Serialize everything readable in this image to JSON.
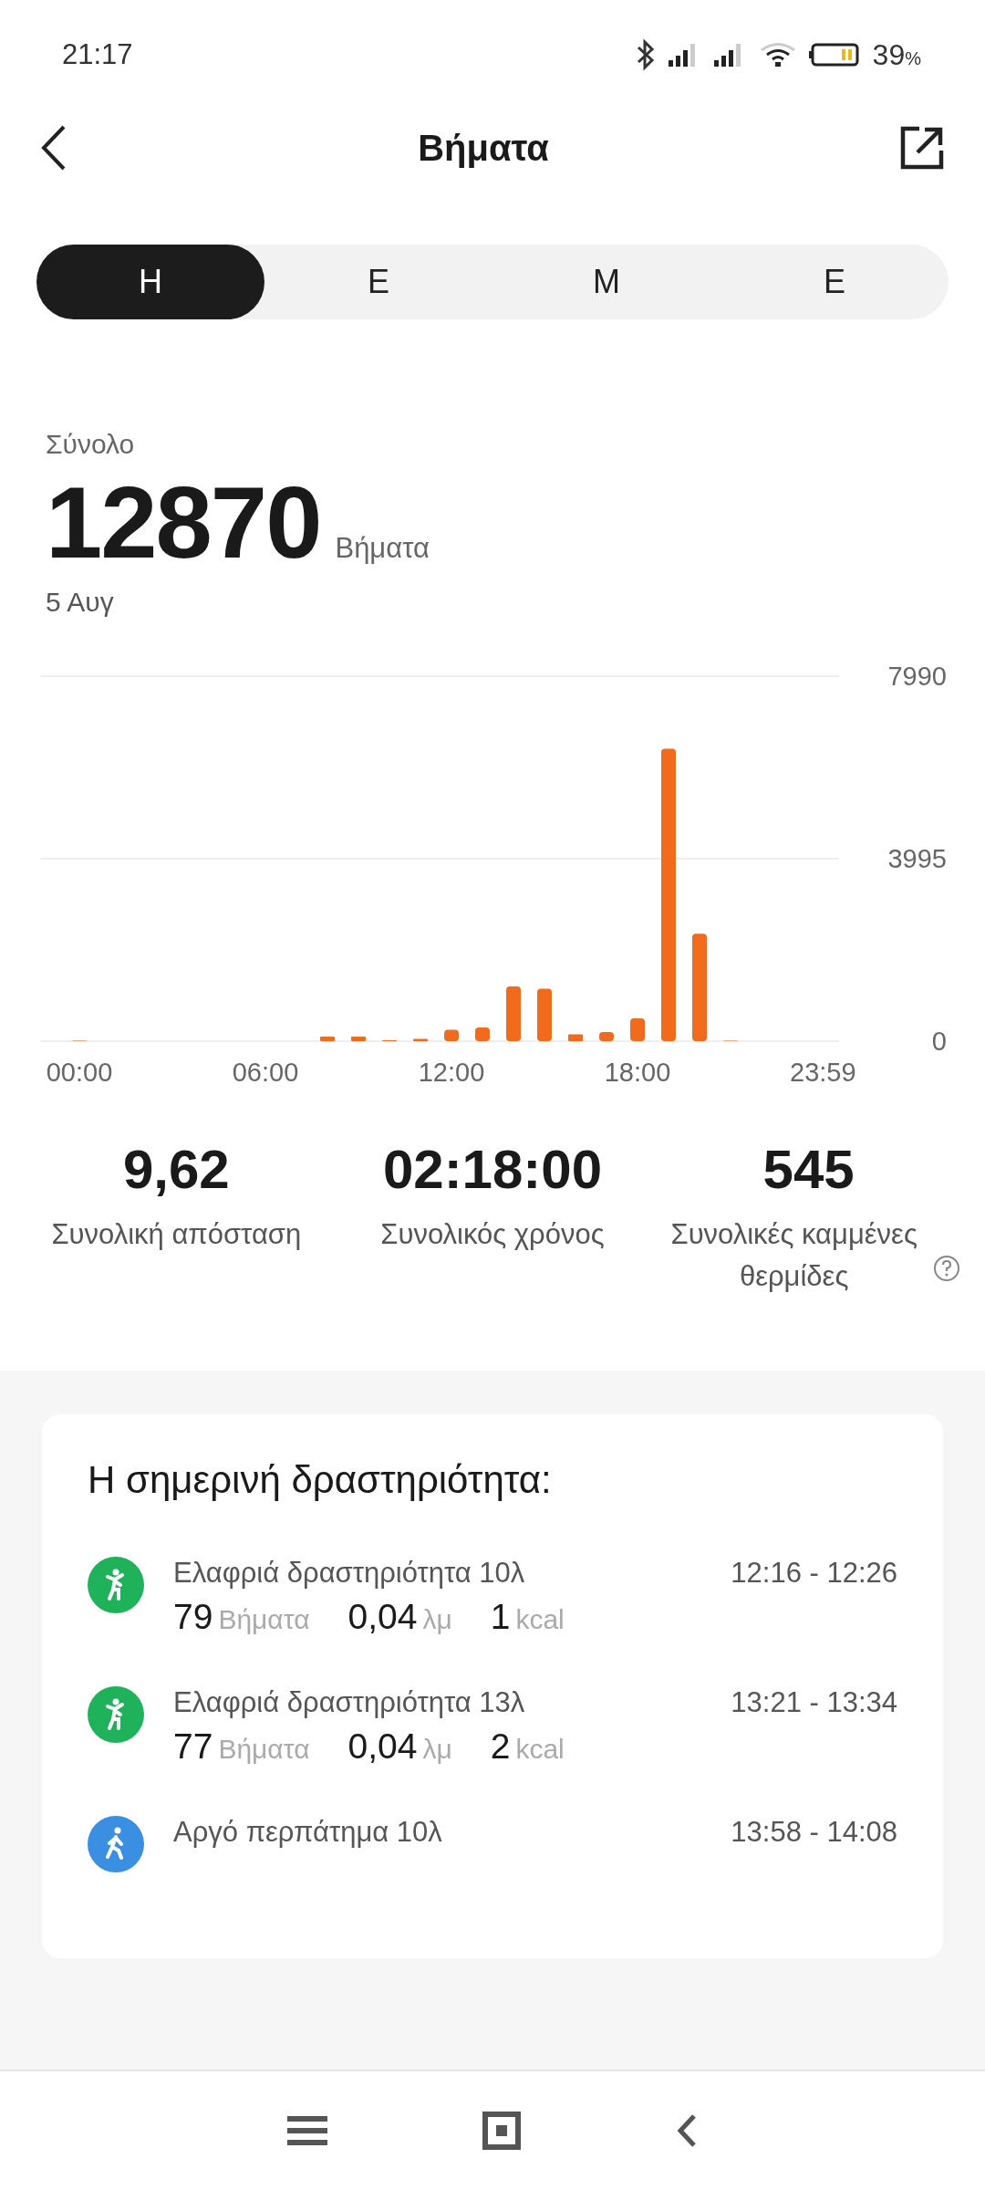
{
  "status_bar": {
    "time": "21:17",
    "battery": "39",
    "battery_unit": "%"
  },
  "header": {
    "title": "Βήματα"
  },
  "tabs": [
    {
      "label": "Η",
      "selected": true
    },
    {
      "label": "Ε",
      "selected": false
    },
    {
      "label": "Μ",
      "selected": false
    },
    {
      "label": "Ε",
      "selected": false
    }
  ],
  "summary": {
    "label": "Σύνολο",
    "value": "12870",
    "unit": "Βήματα",
    "date": "5 Αυγ"
  },
  "chart_data": {
    "type": "bar",
    "x": [
      0,
      1,
      2,
      3,
      4,
      5,
      6,
      7,
      8,
      9,
      10,
      11,
      12,
      13,
      14,
      15,
      16,
      17,
      18,
      19,
      20,
      21,
      22,
      23
    ],
    "values": [
      10,
      0,
      0,
      0,
      0,
      0,
      0,
      0,
      100,
      100,
      20,
      50,
      250,
      300,
      1200,
      1150,
      150,
      200,
      500,
      6400,
      2350,
      10,
      0,
      0
    ],
    "xlim": [
      -1.25,
      24.5
    ],
    "ylim": [
      0,
      7990
    ],
    "yticks": [
      0,
      3995,
      7990
    ],
    "xticks": [
      {
        "value": 0,
        "label": "00:00"
      },
      {
        "value": 6,
        "label": "06:00"
      },
      {
        "value": 12,
        "label": "12:00"
      },
      {
        "value": 18,
        "label": "18:00"
      },
      {
        "value": 23.98,
        "label": "23:59"
      }
    ]
  },
  "stats": [
    {
      "value": "9,62",
      "label": "Συνολική απόσταση",
      "help": false
    },
    {
      "value": "02:18:00",
      "label": "Συνολικός χρόνος",
      "help": false
    },
    {
      "value": "545",
      "label": "Συνολικές καμμένες θερμίδες",
      "help": true
    }
  ],
  "activity": {
    "title": "Η σημερινή δραστηριότητα:",
    "items": [
      {
        "kind": "light",
        "color": "#1fb25a",
        "name": "Ελαφριά δραστηριότητα 10λ",
        "time": "12:16 - 12:26",
        "stats": [
          {
            "value": "79",
            "unit": "Βήματα"
          },
          {
            "value": "0,04",
            "unit": "λμ"
          },
          {
            "value": "1",
            "unit": "kcal"
          }
        ]
      },
      {
        "kind": "light",
        "color": "#1fb25a",
        "name": "Ελαφριά δραστηριότητα 13λ",
        "time": "13:21 - 13:34",
        "stats": [
          {
            "value": "77",
            "unit": "Βήματα"
          },
          {
            "value": "0,04",
            "unit": "λμ"
          },
          {
            "value": "2",
            "unit": "kcal"
          }
        ]
      },
      {
        "kind": "walk",
        "color": "#3b8fe2",
        "name": "Αργό περπάτημα 10λ",
        "time": "13:58 - 14:08"
      }
    ]
  }
}
